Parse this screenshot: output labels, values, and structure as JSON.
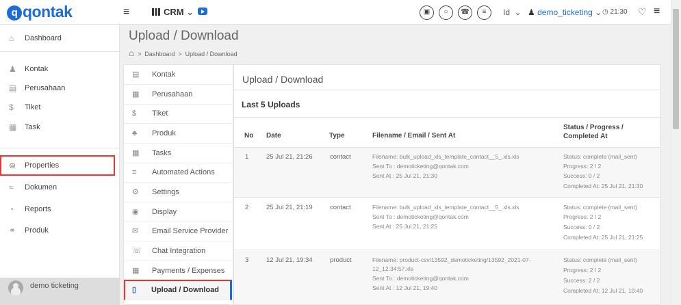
{
  "app": {
    "logo": "qontak",
    "module": "CRM",
    "lang": "Id",
    "username": "demo_ticketing",
    "time": "21:30"
  },
  "sidebar": {
    "items": [
      {
        "label": "Dashboard",
        "icon": "home-icon"
      },
      {
        "label": "Kontak",
        "icon": "contacts-icon"
      },
      {
        "label": "Perusahaan",
        "icon": "building-icon"
      },
      {
        "label": "Tiket",
        "icon": "dollar-icon"
      },
      {
        "label": "Task",
        "icon": "calendar-icon"
      },
      {
        "label": "Properties",
        "icon": "properties-icon"
      },
      {
        "label": "Dokumen",
        "icon": "layers-icon"
      },
      {
        "label": "Reports",
        "icon": "reports-icon"
      },
      {
        "label": "Produk",
        "icon": "tag-icon"
      }
    ],
    "user": "demo ticketing"
  },
  "page": {
    "title": "Upload / Download",
    "breadcrumb": {
      "home": "Dashboard",
      "current": "Upload / Download"
    }
  },
  "settings_menu": [
    "Kontak",
    "Perusahaan",
    "Tiket",
    "Produk",
    "Tasks",
    "Automated Actions",
    "Settings",
    "Display",
    "Email Service Provider",
    "Chat Integration",
    "Payments / Expenses",
    "Upload / Download"
  ],
  "panel": {
    "title": "Upload / Download",
    "section": "Last 5 Uploads",
    "columns": [
      "No",
      "Date",
      "Type",
      "Filename / Email / Sent At",
      "Status / Progress /",
      "Completed At"
    ],
    "rows": [
      {
        "no": "1",
        "date": "25 Jul 21, 21:26",
        "type": "contact",
        "file": "Filename: bulk_upload_xls_template_contact__5_.xls.xls",
        "sent_to": "Sent To : demoticketing@qontak.com",
        "sent_at": "Sent At : 25 Jul 21, 21:30",
        "status": "Status: complete (mail_sent)",
        "progress": "Progress: 2 / 2",
        "success": "Success: 0 / 2",
        "completed": "Completed At: 25 Jul 21, 21:30"
      },
      {
        "no": "2",
        "date": "25 Jul 21, 21:19",
        "type": "contact",
        "file": "Filename: bulk_upload_xls_template_contact__5_.xls.xls",
        "sent_to": "Sent To : demoticketing@qontak.com",
        "sent_at": "Sent At : 25 Jul 21, 21:25",
        "status": "Status: complete (mail_sent)",
        "progress": "Progress: 2 / 2",
        "success": "Success: 0 / 2",
        "completed": "Completed At: 25 Jul 21, 21:25"
      },
      {
        "no": "3",
        "date": "12 Jul 21, 19:34",
        "type": "product",
        "file": "Filename: product-csv/13592_demoticketing/13592_2021-07-",
        "file2": "12_12:34:57.xls",
        "sent_to": "Sent To : demoticketing@qontak.com",
        "sent_at": "Sent At : 12 Jul 21, 19:40",
        "status": "Status: complete (mail_sent)",
        "progress": "Progress: 2 / 2",
        "success": "Success: 2 / 2",
        "completed": "Completed At: 12 Jul 21, 19:40"
      }
    ]
  }
}
